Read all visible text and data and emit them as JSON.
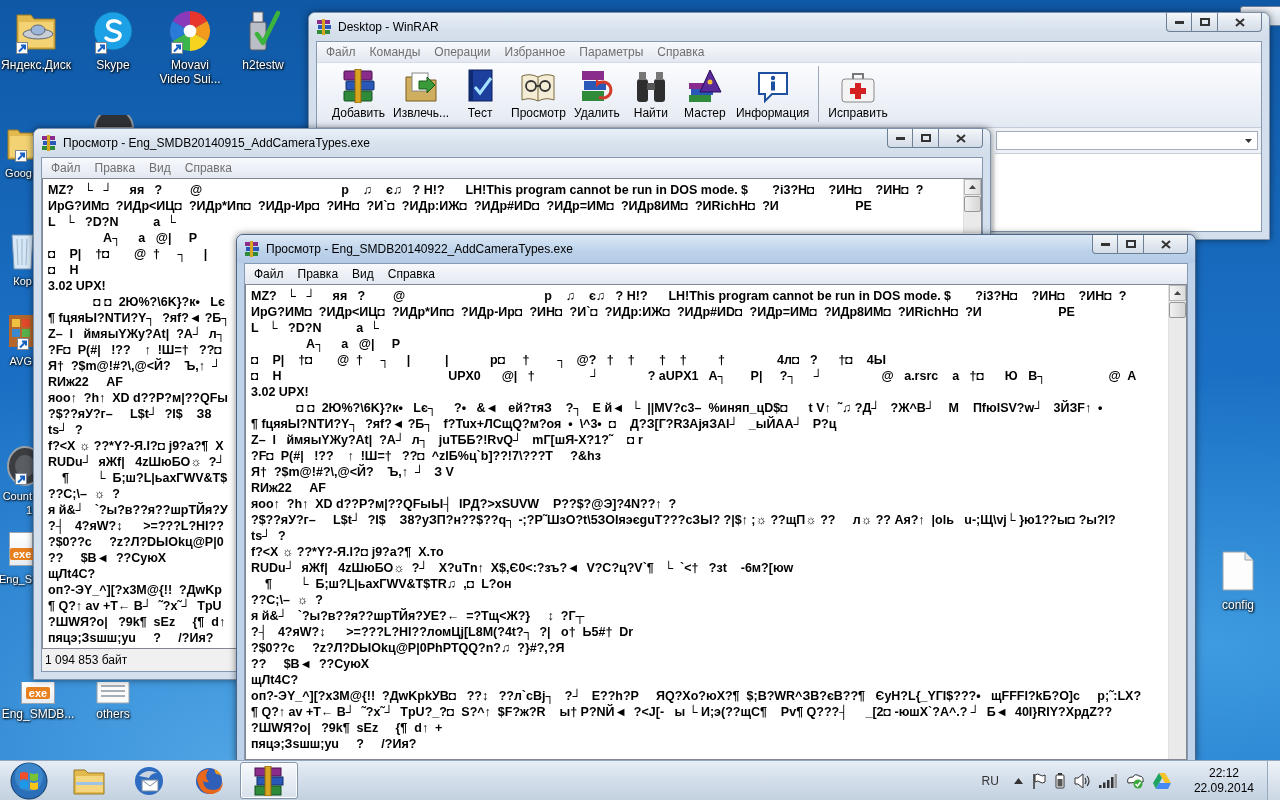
{
  "desktop_icons": [
    {
      "lines": [
        "Яндекс.Диск"
      ],
      "shortcut": true
    },
    {
      "lines": [
        "Skype"
      ],
      "shortcut": true
    },
    {
      "lines": [
        "Movavi",
        "Video Sui..."
      ],
      "shortcut": true
    },
    {
      "lines": [
        "h2testw"
      ],
      "shortcut": false
    },
    {
      "lines": [
        "Goog"
      ],
      "shortcut": true
    },
    {
      "lines": [
        "Кор"
      ],
      "shortcut": false
    },
    {
      "lines": [
        "AVG"
      ],
      "shortcut": true
    },
    {
      "lines": [
        "Count",
        "1"
      ],
      "shortcut": true
    },
    {
      "lines": [
        "Eng_S"
      ],
      "shortcut": false,
      "badge": "exe"
    },
    {
      "lines": [
        "Eng_SMDB..."
      ],
      "shortcut": false,
      "badge": "exe"
    },
    {
      "lines": [
        "others"
      ],
      "shortcut": false
    },
    {
      "lines": [
        "config"
      ],
      "shortcut": false
    }
  ],
  "winrar_window": {
    "title": "Desktop - WinRAR",
    "active": false,
    "menu": [
      "Файл",
      "Команды",
      "Операции",
      "Избранное",
      "Параметры",
      "Справка"
    ],
    "toolbar_groups": [
      [
        {
          "label": "Добавить"
        },
        {
          "label": "Извлечь..."
        },
        {
          "label": "Тест"
        },
        {
          "label": "Просмотр"
        },
        {
          "label": "Удалить"
        },
        {
          "label": "Найти"
        },
        {
          "label": "Мастер"
        },
        {
          "label": "Информация"
        }
      ],
      [
        {
          "label": "Исправить"
        }
      ]
    ]
  },
  "viewer_windows": [
    {
      "title": "Просмотр - Eng_SMDB20140915_AddCameraTypes.exe",
      "active": false,
      "menu": [
        "Файл",
        "Правка",
        "Вид",
        "Справка"
      ],
      "lines": [
        "MZ?   └   ┘     яя   ?        @                                        р    ♫    є♫   ? H!?      LH!This program cannot be run in DOS mode. $       ?i3?H◘    ?ИН◘    ?ИН◘  ?",
        "ИрG?ИМ◘  ?ИДр<ИЦ◘  ?ИДр*Ип◘  ?ИДр-Ир◘  ?ИН◘  ?И`◘  ?ИДр:ИЖ◘  ?ИДр#ИD◘  ?ИДр=ИМ◘  ?ИДр8ИМ◘  ?ИRichH◘  ?И                      PE",
        "L   └   ?D?N          a  └",
        "                A┐     a   @|     P",
        "◘    P|    †◘       @  †     ┐     |",
        "◘    H",
        "3.02 UPX!",
        "             ◘ ◘  2Ю%?\\6K}?к•   Lє",
        "¶ fцяяЫ?NTИ?Y┐  ?яf?◄ ?Б┐",
        "Z–  l   ймяыYЖу?At|  ?A┘  л┐",
        "?F◘  P(#|   !??    ↑  !Ш=†   ??◘",
        "Я†  ?$m@!#?\\,@<Й?    Ъ,↑  ┘",
        "RИж22     AF",
        "яоо↑  ?h↑  XD d??P?м|??QFы",
        "?$??яУ?г–     L$t┘  ?I$    З8",
        "ts┘  ?",
        "f?<X ☼ ??*Y?-Я.I?◘ j9?a?¶  X",
        "RUDu┘  яЖf|   4zШюБО☼  ?┘",
        "    ¶        └  Б;ш?L|ьахГWV&T$",
        "??C;\\–  ☼  ?",
        "я й&┘   `?ы?в??я??шрТЙя?У",
        "?┤   4?яW?↕      >=???L?HI??",
        "?$0??c     ?z?Л?DЫOkц@P|0",
        "??     $B◄  ??СуюX",
        "щЛt4C?",
        "оп?-ЭY_^][?x3M@{!!  ?ДwKp",
        "¶ Q?↑ av +T← B┘  ˜?x˜┘  TpU",
        "?ШWЯ?о|   ?9k¶  sEz     {¶  d↑",
        "пяцэ;Зsшш;yu     ?     /?Ия?"
      ],
      "status": "1 094 853 байт"
    },
    {
      "title": "Просмотр - Eng_SMDB20140922_AddCameraTypes.exe",
      "active": true,
      "menu": [
        "Файл",
        "Правка",
        "Вид",
        "Справка"
      ],
      "lines": [
        "MZ?   └   ┘     яя   ?        @                                        р    ♫    є♫   ? H!?      LH!This program cannot be run in DOS mode. $       ?i3?H◘    ?ИН◘    ?ИН◘  ?",
        "ИрG?ИМ◘  ?ИДр<ИЦ◘  ?ИДр*Ип◘  ?ИДр-Ир◘  ?ИН◘  ?И`◘  ?ИДр:ИЖ◘  ?ИДр#ИD◘  ?ИДр=ИМ◘  ?ИДр8ИМ◘  ?ИRichH◘  ?И                      PE",
        "L   └   ?D?N          a  └",
        "                A┐     a   @|     P",
        "◘    P|    †◘       @  †     ┐     |          |            р◘     †        ┐   @?   †    †       †    †         †               4л◘   ?      †◘    4Ы",
        "◘    H                                                UPX0      @|   †                ┘              ? aUPX1   A┐       P|     ?┐     ┘                 @   a.rsrc    a   †◘      Ю   B┐                  @  A",
        "3.02 UPX!",
        "             ◘ ◘  2Ю%?\\6K}?к•   Lє┐     ?•   &◄   ей?тяЗ    ?┐   Е й◄  └  ||MV?c3–  %иняп_цD$◘      t V↑  ˜♫ ?Д┘   ?Ж^B┘    M    ПfюlSV?w┘   3ЙЗF↑  •",
        "¶ fцяяЫ?NTИ?Y┐  ?яf?◄ ?Б┐   f?Tux+ЛСщQ?м?оя  •  \\^3•  ◘    Д?З[Г?R3АjяЗАl┘   _ыЙАА┘   P?ц",
        "Z–  l   ймяыYЖу?At|  ?A┘  л┐   juТББ?!RvQ┘   mГ[шЯ-X?1?˜    ◘ r",
        "?F◘  P(#|   !??    ↑  !Ш=†   ??◘  ^zIБ%ц`b]??!7\\???T     ?&hз",
        "Я†  ?$m@!#?\\,@<Й?    Ъ,↑  ┘   З V",
        "RИж22     AF",
        "яоо↑  ?h↑  XD d??P?м|??QFыЫ┤  IPД?>xSUVW    P??$?@Э]?4N??↑  ?",
        "?$??яУ?г–     L$t┘  ?I$    З8?уЗП?н??$??q┐ -;?P˜ШзО?t\\5ЗОIяэєguT???cЗЫ? ?|$↑ ;☼ ??щП☼ ??     л☼ ?? Ая?↑  |оlь   u-;Щ\\vj└ }ю1??ы◘ ?ы?I?",
        "ts┘  ?",
        "f?<X ☼ ??*Y?-Я.I?◘ j9?a?¶  X.то",
        "RUDu┘  яЖf|   4zШюБО☼  ?┘   X?uTn↑  X$,Є0<:?зъ?◄  V?C?ц?V`¶   └  `<†   ?зt    -6м?[юw",
        "    ¶        └  Б;ш?L|ьахГWV&T$TR♫  ,◘  L?он",
        "??C;\\–  ☼  ?",
        "я й&┘   `?ы?в??я??шрТЙя?УЕ?←  =?Тщ<Ж?}     ↕  ?Г┬",
        "?┤   4?яW?↕      >=???L?HI??ломЦj[L8M(?4t?┐  ?|   о†  Ь5#†  Dr",
        "?$0??c     ?z?Л?DЫOkц@P|0PhPTQQ?n?♫  ?}#?,?Я",
        "??     $B◄  ??СуюX",
        "щЛt4C?",
        "оп?-ЭY_^][?x3M@{!!  ?ДwKpkУВ◘   ??↕   ??л`cBj┐   ?┘   E??h?P     ЯQ?Xо?юX?¶  $;B?WR^ЗB?єB??¶   ЄуН?L{_YГI$???•   щFFFI?kБ?O]c     р;˜:LX?",
        "¶ Q?↑ av +T← B┘  ˜?x˜┘  TpU?_?◘  S?^↑  $F?ж?R    ы† P?NЙ◄  ?<J[-   ы └ И;э(??щС¶    Pv¶ Q???┤     _[2◘ -юшX`?А^.? ┘  Б◄  40I}RIY?XрдZ??",
        "?ШWЯ?о|   ?9k¶  sEz     {¶  d↑  +",
        "пяцэ;Зsшш;yu     ?     /?Ия?"
      ]
    }
  ],
  "taskbar": {
    "apps": [
      {
        "active": false
      },
      {
        "active": false
      },
      {
        "active": false
      },
      {
        "active": true
      }
    ],
    "language": "RU",
    "time": "22:12",
    "date": "22.09.2014"
  }
}
